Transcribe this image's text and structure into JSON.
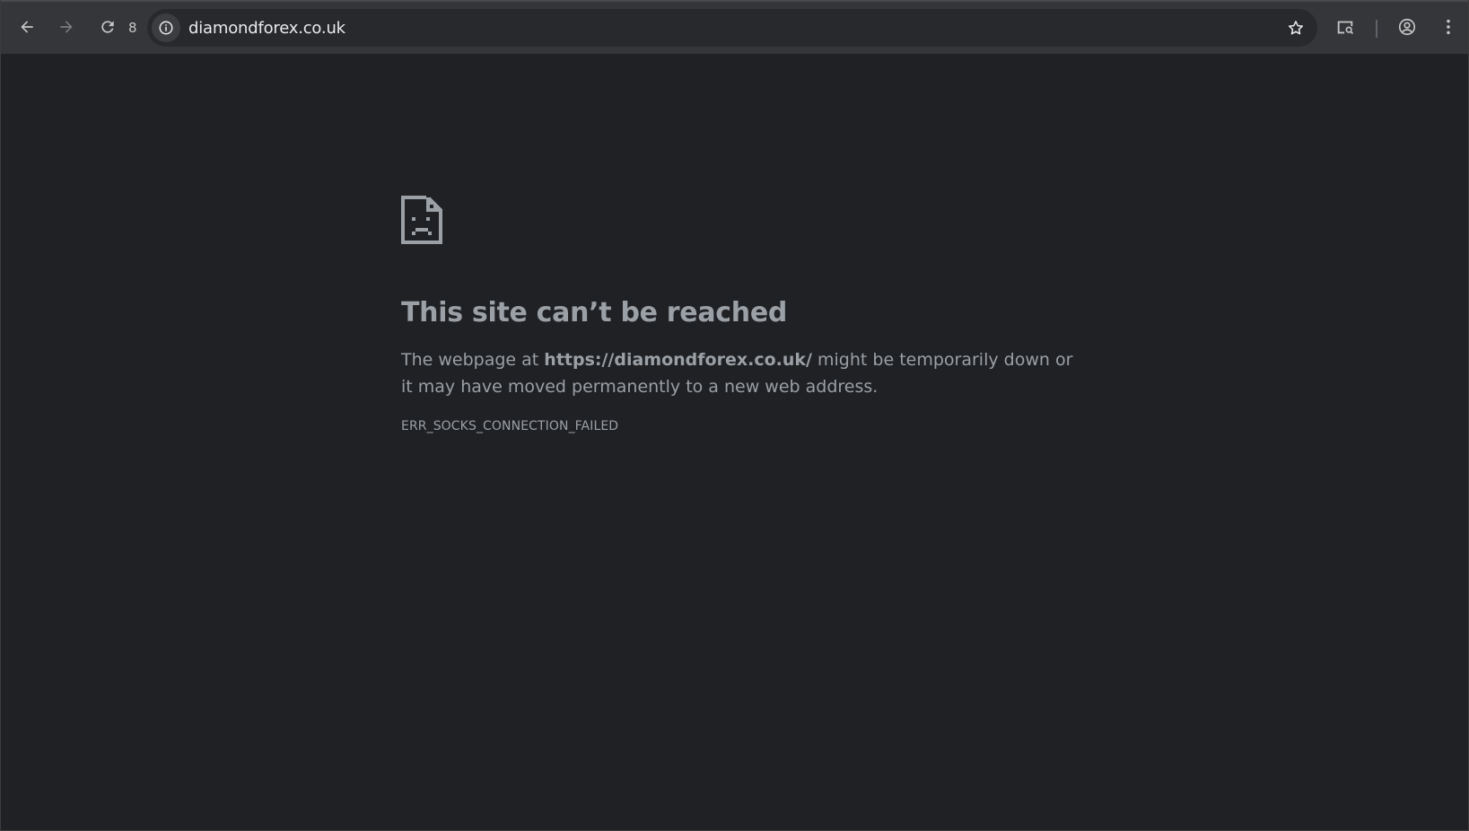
{
  "toolbar": {
    "back_icon": "arrow-left-icon",
    "forward_icon": "arrow-right-icon",
    "reload_icon": "reload-icon",
    "reload_count": "8",
    "url": "diamondforex.co.uk",
    "site_info_icon": "info-icon",
    "bookmark_icon": "star-icon",
    "lens_icon": "search-page-icon",
    "profile_icon": "account-circle-icon",
    "menu_icon": "kebab-menu-icon"
  },
  "error_page": {
    "icon": "sad-document-icon",
    "title": "This site can’t be reached",
    "desc_prefix": "The webpage at ",
    "desc_url": "https://diamondforex.co.uk/",
    "desc_suffix": " might be temporarily down or it may have moved permanently to a new web address.",
    "error_code": "ERR_SOCKS_CONNECTION_FAILED"
  },
  "colors": {
    "background": "#202124",
    "toolbar": "#35363a",
    "omnibox": "#28292c",
    "text_muted": "#9aa0a6",
    "text_bright": "#e8eaed"
  }
}
